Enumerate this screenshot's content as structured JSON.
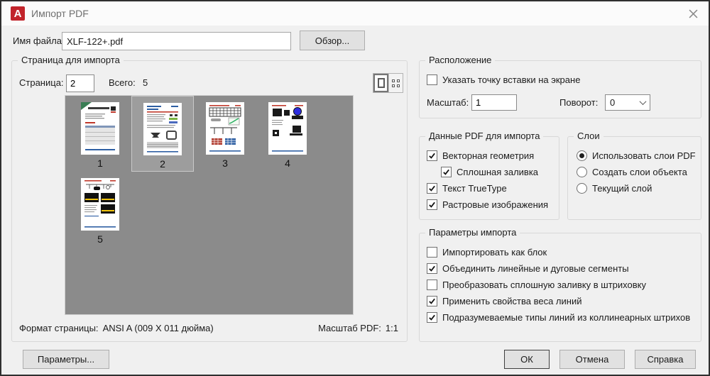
{
  "window": {
    "title": "Импорт PDF",
    "app_icon": "autocad-logo",
    "close_icon": "close-x"
  },
  "file": {
    "label": "Имя файла:",
    "value": "XLF-122+.pdf",
    "browse_label": "Обзор..."
  },
  "page_group": {
    "title": "Страница для импорта",
    "page_label": "Страница:",
    "page_value": "2",
    "total_label": "Всего:",
    "total_value": "5",
    "view_icons": [
      "single-page-view",
      "grid-view"
    ],
    "pages": [
      {
        "number": "1",
        "selected": false
      },
      {
        "number": "2",
        "selected": true
      },
      {
        "number": "3",
        "selected": false
      },
      {
        "number": "4",
        "selected": false
      },
      {
        "number": "5",
        "selected": false
      }
    ],
    "format_label": "Формат страницы:",
    "format_value": "ANSI A (009 X 011 дюйма)",
    "pdf_scale_label": "Масштаб PDF:",
    "pdf_scale_value": "1:1"
  },
  "location_group": {
    "title": "Расположение",
    "specify_point": {
      "id": "specify-insertion-point",
      "label": "Указать точку вставки на экране",
      "checked": false
    },
    "scale": {
      "label": "Масштаб:",
      "value": "1"
    },
    "rotation": {
      "label": "Поворот:",
      "value": "0",
      "icon": "chevron-down"
    }
  },
  "pdf_data_group": {
    "title": "Данные PDF для импорта",
    "items": [
      {
        "id": "vector-geometry",
        "label": "Векторная геометрия",
        "checked": true,
        "indent": 0
      },
      {
        "id": "solid-fill",
        "label": "Сплошная заливка",
        "checked": true,
        "indent": 1
      },
      {
        "id": "truetype-text",
        "label": "Текст TrueType",
        "checked": true,
        "indent": 0
      },
      {
        "id": "raster-images",
        "label": "Растровые изображения",
        "checked": true,
        "indent": 0
      }
    ]
  },
  "layers_group": {
    "title": "Слои",
    "options": [
      {
        "id": "use-pdf-layers",
        "label": "Использовать слои PDF",
        "selected": true
      },
      {
        "id": "create-object-layers",
        "label": "Создать слои объекта",
        "selected": false
      },
      {
        "id": "current-layer",
        "label": "Текущий слой",
        "selected": false
      }
    ]
  },
  "import_options_group": {
    "title": "Параметры импорта",
    "items": [
      {
        "id": "import-as-block",
        "label": "Импортировать как блок",
        "checked": false,
        "indent": 0
      },
      {
        "id": "join-line-arc-segments",
        "label": "Объединить линейные и дуговые сегменты",
        "checked": true,
        "indent": 0
      },
      {
        "id": "convert-fills-to-hatches",
        "label": "Преобразовать сплошную заливку в штриховку",
        "checked": false,
        "indent": 0
      },
      {
        "id": "apply-lineweight-properties",
        "label": "Применить свойства веса линий",
        "checked": true,
        "indent": 0
      },
      {
        "id": "infer-linetypes-from-dashes",
        "label": "Подразумеваемые типы линий из коллинеарных штрихов",
        "checked": true,
        "indent": 0
      }
    ]
  },
  "footer": {
    "options_label": "Параметры...",
    "ok_label": "ОК",
    "cancel_label": "Отмена",
    "help_label": "Справка"
  },
  "colors": {
    "accent_red": "#c2242b",
    "panel_gray": "#8b8b8b",
    "selected_cell": "#9d9d9d",
    "dialog_bg": "#f0f0f0"
  }
}
